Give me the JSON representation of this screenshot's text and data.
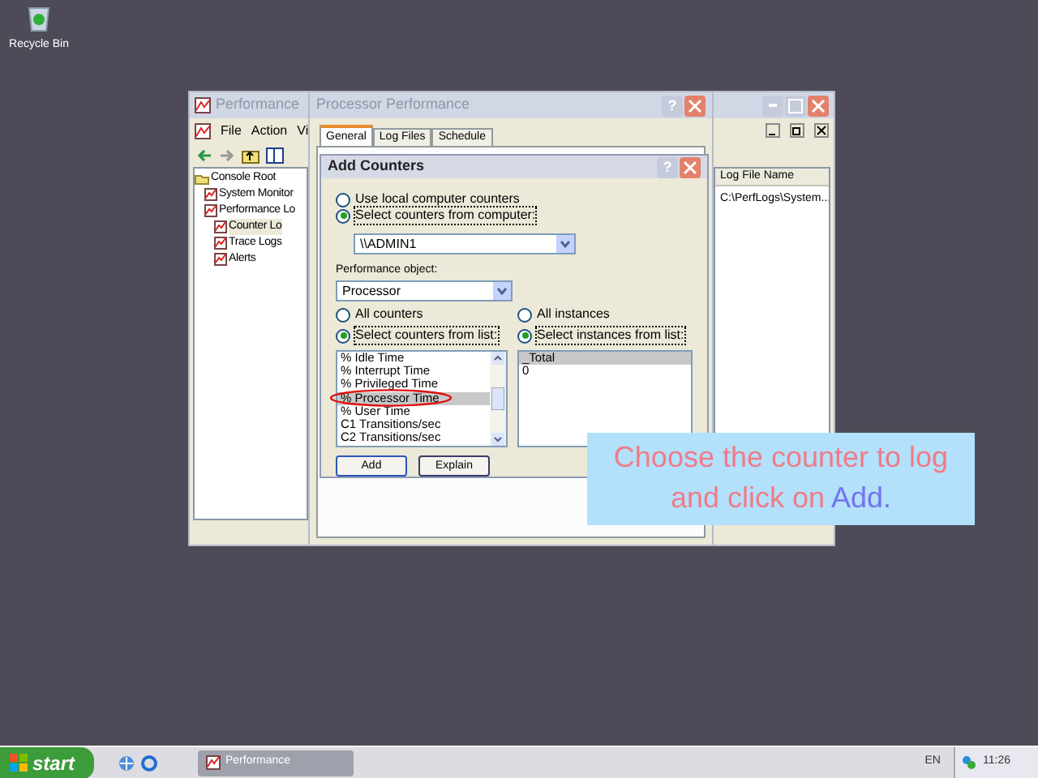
{
  "desktop_icons": [
    {
      "label": "Recycle Bin"
    }
  ],
  "mmc_window": {
    "title": "Performance",
    "menu": [
      "File",
      "Action",
      "Vi"
    ],
    "tree": [
      {
        "label": "Console Root",
        "selected": false,
        "children": [
          {
            "label": "System Monitor",
            "selected": false
          },
          {
            "label": "Performance Lo",
            "selected": false,
            "children": [
              {
                "label": "Counter Lo",
                "selected": true
              },
              {
                "label": "Trace Logs",
                "selected": false
              },
              {
                "label": "Alerts",
                "selected": false
              }
            ]
          }
        ]
      }
    ],
    "list": {
      "columns": [
        "Log File Name"
      ],
      "rows": [
        [
          "C:\\PerfLogs\\System..."
        ]
      ]
    }
  },
  "properties_dialog": {
    "title": "Processor Performance",
    "help_button": "?",
    "tabs": [
      {
        "label": "General",
        "selected": true
      },
      {
        "label": "Log Files",
        "selected": false
      },
      {
        "label": "Schedule",
        "selected": false
      }
    ]
  },
  "add_counters": {
    "title": "Add Counters",
    "help_button": "?",
    "source_options": [
      {
        "label": "Use local computer counters",
        "selected": false
      },
      {
        "label": "Select counters from computer:",
        "selected": true
      }
    ],
    "computer": "\\\\ADMIN1",
    "object_label": "Performance object:",
    "object": "Processor",
    "counter_modes": [
      {
        "label": "All counters",
        "selected": false
      },
      {
        "label": "Select counters from list:",
        "selected": true
      }
    ],
    "instance_modes": [
      {
        "label": "All instances",
        "selected": false
      },
      {
        "label": "Select instances from list:",
        "selected": true
      }
    ],
    "counters": [
      {
        "label": "% Idle Time",
        "selected": false
      },
      {
        "label": "% Interrupt Time",
        "selected": false
      },
      {
        "label": "% Privileged Time",
        "selected": false
      },
      {
        "label": "% Processor Time",
        "selected": true
      },
      {
        "label": "% User Time",
        "selected": false
      },
      {
        "label": "C1 Transitions/sec",
        "selected": false
      },
      {
        "label": "C2 Transitions/sec",
        "selected": false
      }
    ],
    "instances": [
      {
        "label": "_Total",
        "selected": true
      },
      {
        "label": "0",
        "selected": false
      }
    ],
    "buttons": [
      "Add",
      "Explain"
    ]
  },
  "caption": {
    "text": "Choose the counter to log and click on",
    "highlight": "Add."
  },
  "taskbar": {
    "start": "start",
    "tasks": [
      {
        "label": "Performance",
        "selected": true
      }
    ],
    "language": "EN",
    "clock": "11:26"
  }
}
